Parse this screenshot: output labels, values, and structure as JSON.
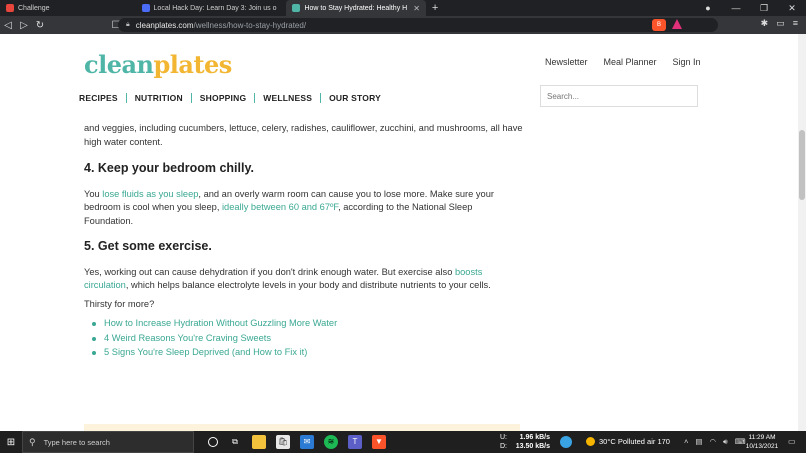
{
  "browser": {
    "tabs": [
      {
        "title": "Challenge",
        "favicon_color": "#e8453c",
        "active": false
      },
      {
        "title": "Local Hack Day: Learn Day 3: Join us o",
        "favicon_color": "#4a6cf7",
        "favicon_letter": "D",
        "active": false
      },
      {
        "title": "How to Stay Hydrated: Healthy H",
        "favicon_color": "#4fb6a7",
        "favicon_letter": "c",
        "active": true
      }
    ],
    "new_tab": "+",
    "url_host": "cleanplates.com",
    "url_path": "/wellness/how-to-stay-hydrated/",
    "window_controls": [
      "—",
      "❐",
      "✕"
    ]
  },
  "site": {
    "logo_part1": "clean",
    "logo_part2": "plates",
    "top_links": [
      "Newsletter",
      "Meal Planner",
      "Sign In"
    ],
    "nav": [
      "RECIPES",
      "NUTRITION",
      "SHOPPING",
      "WELLNESS",
      "OUR STORY"
    ],
    "search_placeholder": "Search..."
  },
  "article": {
    "intro": "and veggies, including cucumbers, lettuce, celery, radishes, cauliflower, zucchini, and mushrooms, all have high water content.",
    "h4": "4. Keep your bedroom chilly.",
    "p4_a": "You ",
    "p4_link1": "lose fluids as you sleep",
    "p4_b": ", and an overly warm room can cause you to lose more. Make sure your bedroom is cool when you sleep, ",
    "p4_link2": "ideally between 60 and 67ºF",
    "p4_c": ", according to the National Sleep Foundation.",
    "h5": "5. Get some exercise.",
    "p5_a": "Yes, working out can cause dehydration if you don't drink enough water. But exercise also ",
    "p5_link": "boosts circulation",
    "p5_b": ", which helps balance electrolyte levels in your body and distribute nutrients to your cells.",
    "more": "Thirsty for more?",
    "links": [
      "How to Increase Hydration Without Guzzling More Water",
      "4 Weird Reasons You're Craving Sweets",
      "5 Signs You're Sleep Deprived (and How to Fix it)"
    ]
  },
  "taskbar": {
    "search_placeholder": "Type here to search",
    "net_up_label": "U:",
    "net_up": "1.96 kB/s",
    "net_down_label": "D:",
    "net_down": "13.50 kB/s",
    "weather": "30°C  Polluted air 170",
    "time": "11:29 AM",
    "date": "10/13/2021"
  }
}
